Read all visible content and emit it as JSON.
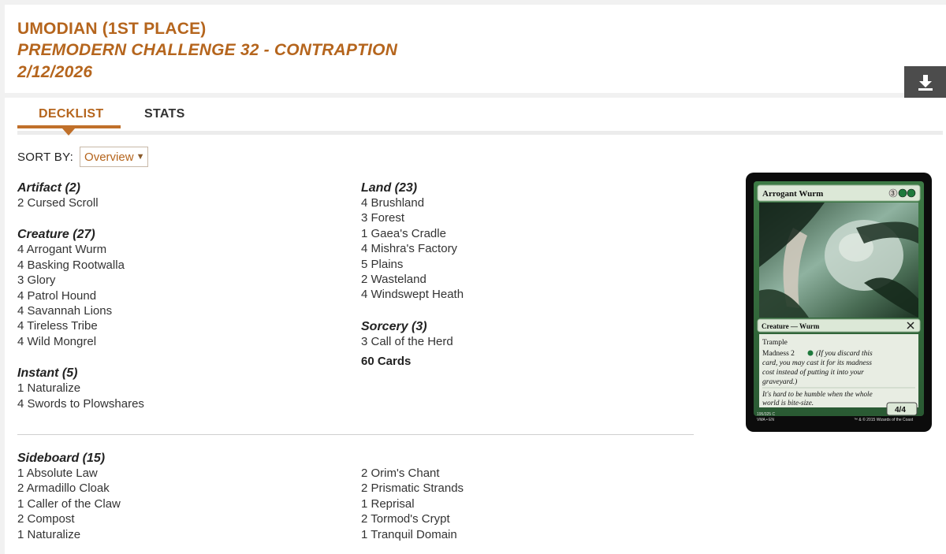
{
  "header": {
    "player": "UMODIAN (1ST PLACE)",
    "event": "PREMODERN CHALLENGE 32 - CONTRAPTION",
    "date": "2/12/2026"
  },
  "tabs": [
    {
      "label": "DECKLIST",
      "active": true
    },
    {
      "label": "STATS",
      "active": false
    }
  ],
  "sort": {
    "label": "SORT BY:",
    "value": "Overview"
  },
  "left_groups": [
    {
      "title": "Artifact (2)",
      "cards": [
        "2 Cursed Scroll"
      ]
    },
    {
      "title": "Creature (27)",
      "cards": [
        "4 Arrogant Wurm",
        "4 Basking Rootwalla",
        "3 Glory",
        "4 Patrol Hound",
        "4 Savannah Lions",
        "4 Tireless Tribe",
        "4 Wild Mongrel"
      ]
    },
    {
      "title": "Instant (5)",
      "cards": [
        "1 Naturalize",
        "4 Swords to Plowshares"
      ]
    }
  ],
  "right_groups": [
    {
      "title": "Land (23)",
      "cards": [
        "4 Brushland",
        "3 Forest",
        "1 Gaea's Cradle",
        "4 Mishra's Factory",
        "5 Plains",
        "2 Wasteland",
        "4 Windswept Heath"
      ]
    },
    {
      "title": "Sorcery (3)",
      "cards": [
        "3 Call of the Herd"
      ]
    }
  ],
  "total": "60 Cards",
  "sideboard": {
    "title": "Sideboard (15)",
    "left": [
      "1 Absolute Law",
      "2 Armadillo Cloak",
      "1 Caller of the Claw",
      "2 Compost",
      "1 Naturalize"
    ],
    "right": [
      "2 Orim's Chant",
      "2 Prismatic Strands",
      "1 Reprisal",
      "2 Tormod's Crypt",
      "1 Tranquil Domain"
    ]
  },
  "card_preview": {
    "name": "Arrogant Wurm",
    "cost": "3",
    "type_line": "Creature — Wurm",
    "rules_1": "Trample",
    "rules_2a": "Madness 2",
    "rules_2b": "(If you discard this",
    "rules_3": "card, you may cast it for its madness",
    "rules_4": "cost instead of putting it into your",
    "rules_5": "graveyard.)",
    "flavor_1": "It's hard to be humble when the whole",
    "flavor_2": "world is bite-size.",
    "pt": "4/4",
    "collector_1": "195/325 C",
    "collector_2": "VMA • EN",
    "copyright": "™ & © 2015 Wizards of the Coast"
  },
  "colors": {
    "accent": "#b5651d",
    "download_bg": "#4c4c4c",
    "card_green": "#2f6b3a"
  }
}
